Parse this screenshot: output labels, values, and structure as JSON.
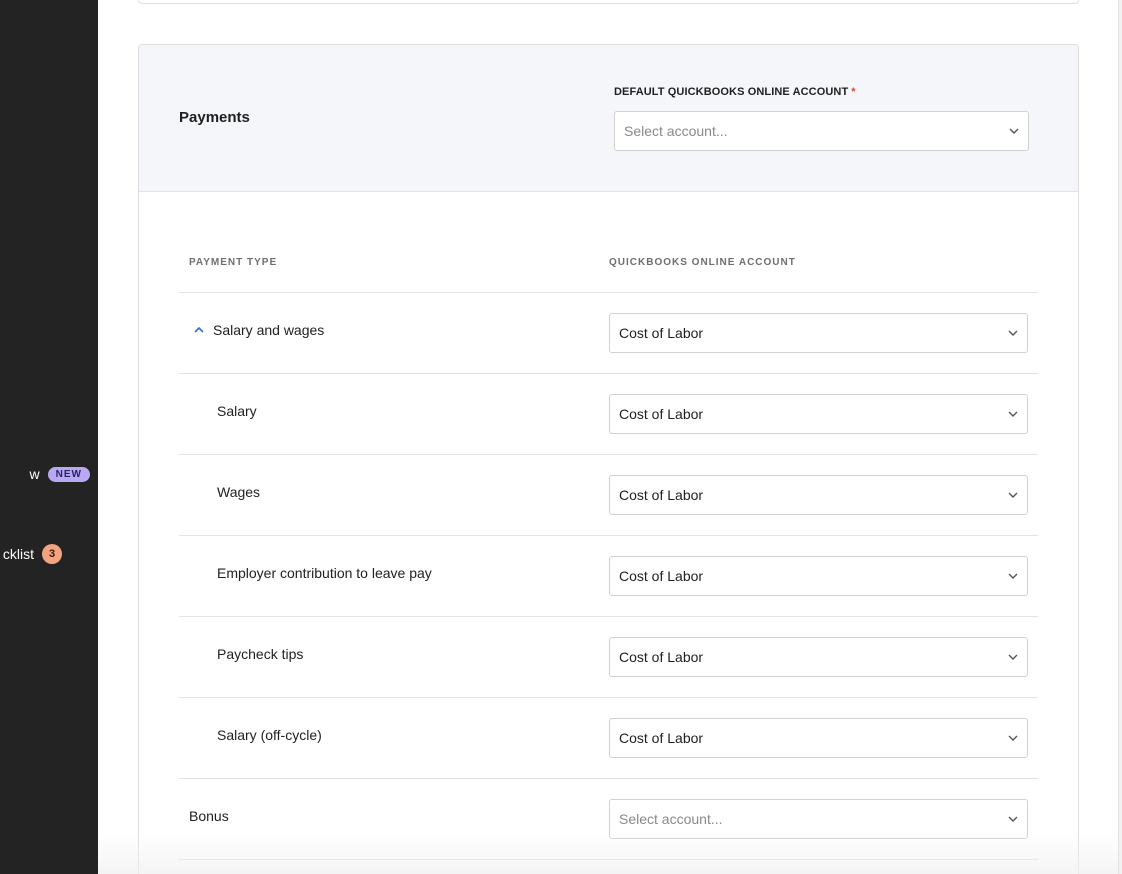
{
  "sidebar": {
    "items": [
      {
        "label": "w",
        "badge": "NEW"
      },
      {
        "label": "cklist",
        "badge": "3"
      }
    ]
  },
  "payments": {
    "title": "Payments",
    "default_account_label": "DEFAULT QUICKBOOKS ONLINE ACCOUNT",
    "required_marker": "*",
    "default_account_placeholder": "Select account..."
  },
  "table": {
    "columns": [
      "PAYMENT TYPE",
      "QUICKBOOKS ONLINE ACCOUNT"
    ],
    "rows": [
      {
        "label": "Salary and wages",
        "account": "Cost of Labor",
        "level": "parent",
        "expanded": true
      },
      {
        "label": "Salary",
        "account": "Cost of Labor",
        "level": "child"
      },
      {
        "label": "Wages",
        "account": "Cost of Labor",
        "level": "child"
      },
      {
        "label": "Employer contribution to leave pay",
        "account": "Cost of Labor",
        "level": "child"
      },
      {
        "label": "Paycheck tips",
        "account": "Cost of Labor",
        "level": "child"
      },
      {
        "label": "Salary (off-cycle)",
        "account": "Cost of Labor",
        "level": "child"
      },
      {
        "label": "Bonus",
        "account": "Select account...",
        "level": "top",
        "placeholder": true
      }
    ]
  },
  "colors": {
    "sidebar_bg": "#232323",
    "accent": "#2f6fd6",
    "badge_new": "#b9a9f2",
    "badge_count": "#f4a37f",
    "required": "#e0452e"
  }
}
